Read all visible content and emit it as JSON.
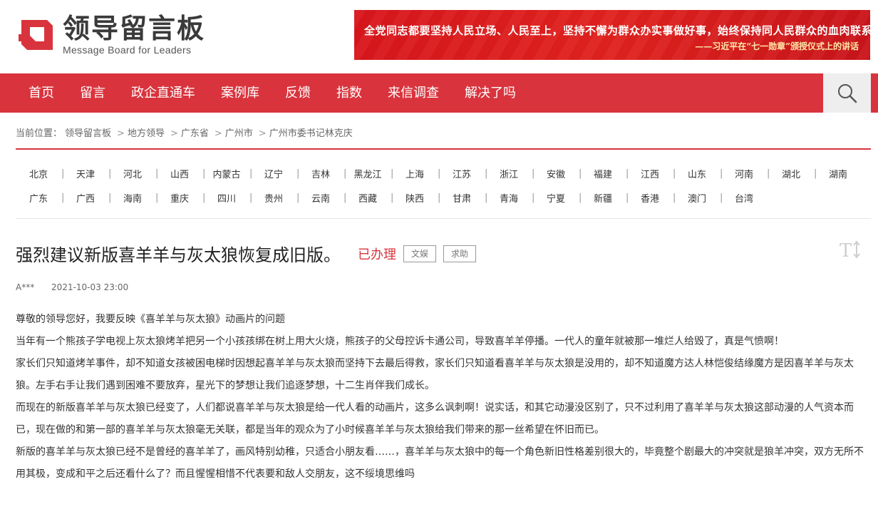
{
  "header": {
    "logo_cn": "领导留言板",
    "logo_en": "Message Board for Leaders",
    "banner_main": "全党同志都要坚持人民立场、人民至上，坚持不懈为群众办实事做好事，始终保持同人民群众的血肉联系。",
    "banner_sub": "——习近平在“七一勋章”颁授仪式上的讲话"
  },
  "nav": {
    "items": [
      "首页",
      "留言",
      "政企直通车",
      "案例库",
      "反馈",
      "指数",
      "来信调查",
      "解决了吗"
    ],
    "search_icon": "search-icon"
  },
  "breadcrumb": {
    "label": "当前位置：",
    "items": [
      "领导留言板",
      "地方领导",
      "广东省",
      "广州市",
      "广州市委书记林克庆"
    ],
    "separator": ">"
  },
  "regions": {
    "row1": [
      "北京",
      "天津",
      "河北",
      "山西",
      "内蒙古",
      "辽宁",
      "吉林",
      "黑龙江",
      "上海",
      "江苏",
      "浙江",
      "安徽",
      "福建",
      "江西",
      "山东",
      "河南",
      "湖北",
      "湖南"
    ],
    "row2": [
      "广东",
      "广西",
      "海南",
      "重庆",
      "四川",
      "贵州",
      "云南",
      "西藏",
      "陕西",
      "甘肃",
      "青海",
      "宁夏",
      "新疆",
      "香港",
      "澳门",
      "台湾"
    ]
  },
  "post": {
    "title": "强烈建议新版喜羊羊与灰太狼恢复成旧版。",
    "status": "已办理",
    "tags": [
      "文娱",
      "求助"
    ],
    "author": "A***",
    "time": "2021-10-03 23:00",
    "paragraphs": [
      "尊敬的领导您好，我要反映《喜羊羊与灰太狼》动画片的问题",
      "当年有一个熊孩子学电视上灰太狼烤羊把另一个小孩孩绑在树上用大火烧，熊孩子的父母控诉卡通公司，导致喜羊羊停播。一代人的童年就被那一堆烂人给毁了，真是气愤啊！",
      "家长们只知道烤羊事件，却不知道女孩被困电梯时因想起喜羊羊与灰太狼而坚持下去最后得救，家长们只知道看喜羊羊与灰太狼是没用的，却不知道魔方达人林恺俊结缘魔方是因喜羊羊与灰太狼。左手右手让我们遇到困难不要放弃，星光下的梦想让我们追逐梦想，十二生肖伴我们成长。",
      "而现在的新版喜羊羊与灰太狼已经变了，人们都说喜羊羊与灰太狼是给一代人看的动画片，这多么讽刺啊！说实话，和其它动漫没区别了，只不过利用了喜羊羊与灰太狼这部动漫的人气资本而已，现在做的和第一部的喜羊羊与灰太狼毫无关联，都是当年的观众为了小时候喜羊羊与灰太狼给我们带来的那一丝希望在怀旧而已。",
      "新版的喜羊羊与灰太狼已经不是曾经的喜羊羊了，画风特别幼稚，只适合小朋友看……，喜羊羊与灰太狼中的每一个角色新旧性格差别很大的，毕竟整个剧最大的冲突就是狼羊冲突，双方无所不用其极，变成和平之后还看什么了？而且惺惺相惜不代表要和敌人交朋友，这不绥境思维吗"
    ]
  },
  "colors": {
    "brand_red": "#d9343d",
    "banner_red": "#d8161c"
  }
}
